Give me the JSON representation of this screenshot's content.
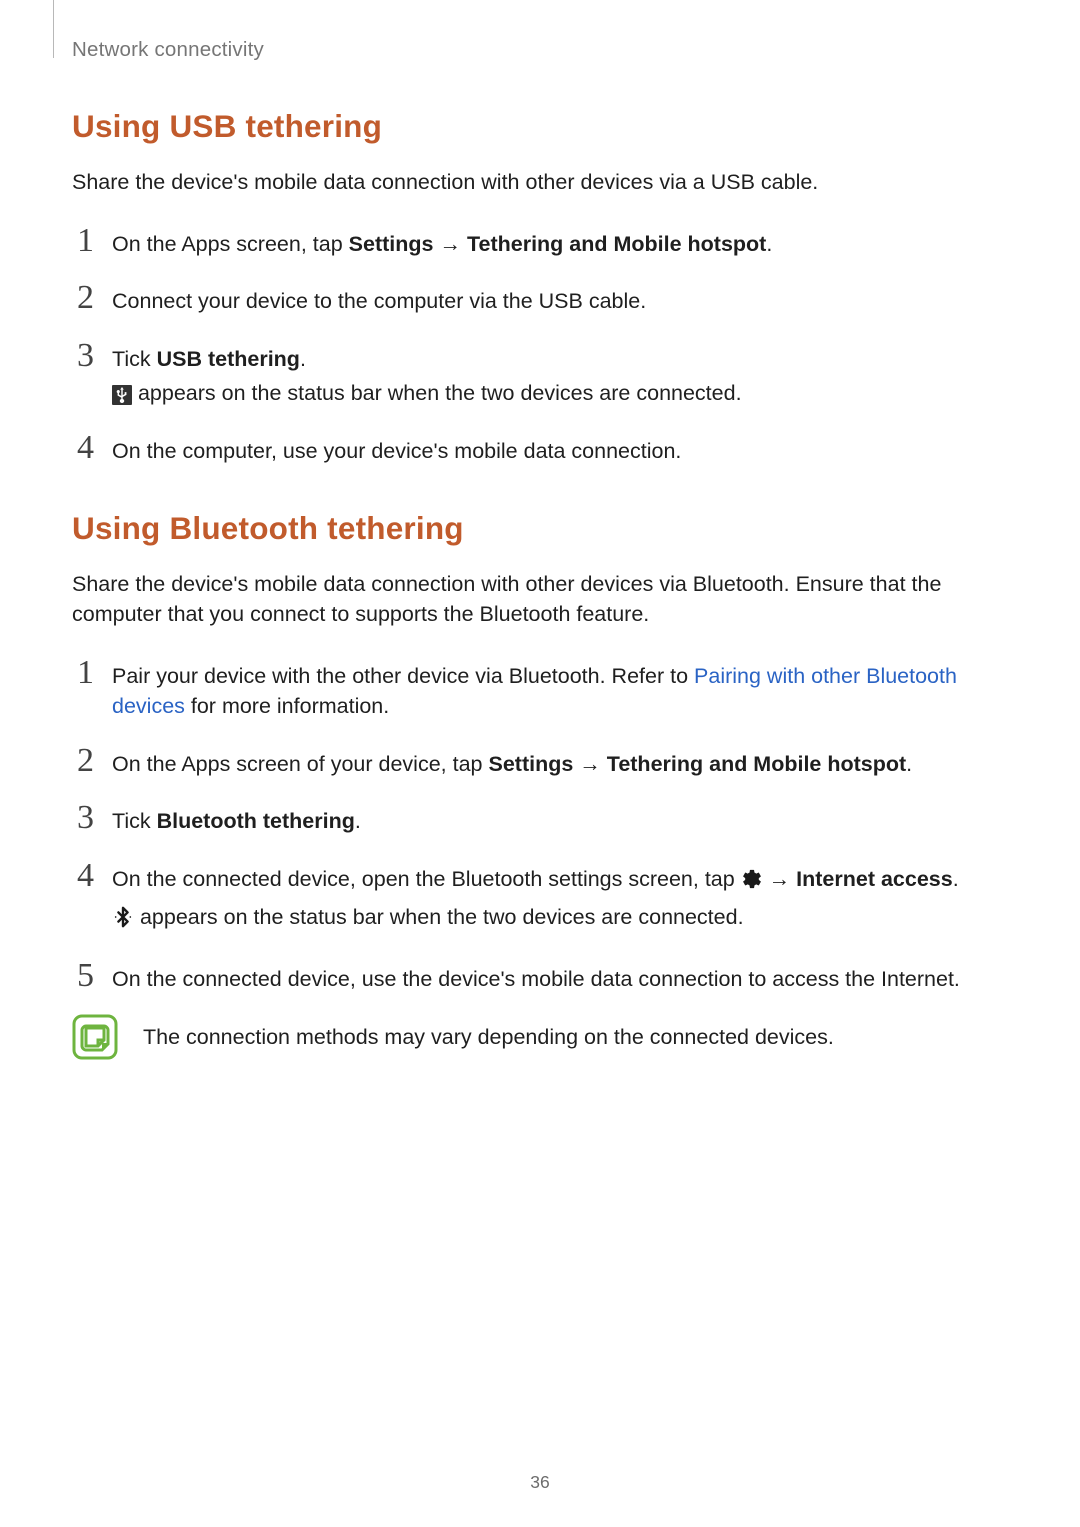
{
  "chapter": "Network connectivity",
  "pageNumber": "36",
  "sectionA": {
    "title": "Using USB tethering",
    "intro": "Share the device's mobile data connection with other devices via a USB cable.",
    "steps": [
      {
        "n": "1",
        "parts": [
          "On the Apps screen, tap ",
          "Settings",
          " ",
          "→",
          " ",
          "Tethering and Mobile hotspot",
          "."
        ]
      },
      {
        "n": "2",
        "parts": [
          "Connect your device to the computer via the USB cable."
        ]
      },
      {
        "n": "3",
        "parts": [
          "Tick ",
          "USB tethering",
          "."
        ],
        "sub_after_icon": " appears on the status bar when the two devices are connected."
      },
      {
        "n": "4",
        "parts": [
          "On the computer, use your device's mobile data connection."
        ]
      }
    ]
  },
  "sectionB": {
    "title": "Using Bluetooth tethering",
    "intro_pre": "Share the device's mobile data connection with other devices via Bluetooth. Ensure that the computer that you connect to supports the Bluetooth feature.",
    "steps": [
      {
        "n": "1",
        "lead": "Pair your device with the other device via Bluetooth. Refer to ",
        "link": "Pairing with other Bluetooth devices",
        "trail": " for more information."
      },
      {
        "n": "2",
        "parts": [
          "On the Apps screen of your device, tap ",
          "Settings",
          " ",
          "→",
          " ",
          "Tethering and Mobile hotspot",
          "."
        ]
      },
      {
        "n": "3",
        "parts": [
          "Tick ",
          "Bluetooth tethering",
          "."
        ]
      },
      {
        "n": "4",
        "lead": "On the connected device, open the Bluetooth settings screen, tap ",
        "arrow": " → ",
        "bold_trail": "Internet access",
        "period": ".",
        "sub_after_icon": " appears on the status bar when the two devices are connected."
      },
      {
        "n": "5",
        "parts": [
          "On the connected device, use the device's mobile data connection to access the Internet."
        ]
      }
    ],
    "note": "The connection methods may vary depending on the connected devices."
  }
}
